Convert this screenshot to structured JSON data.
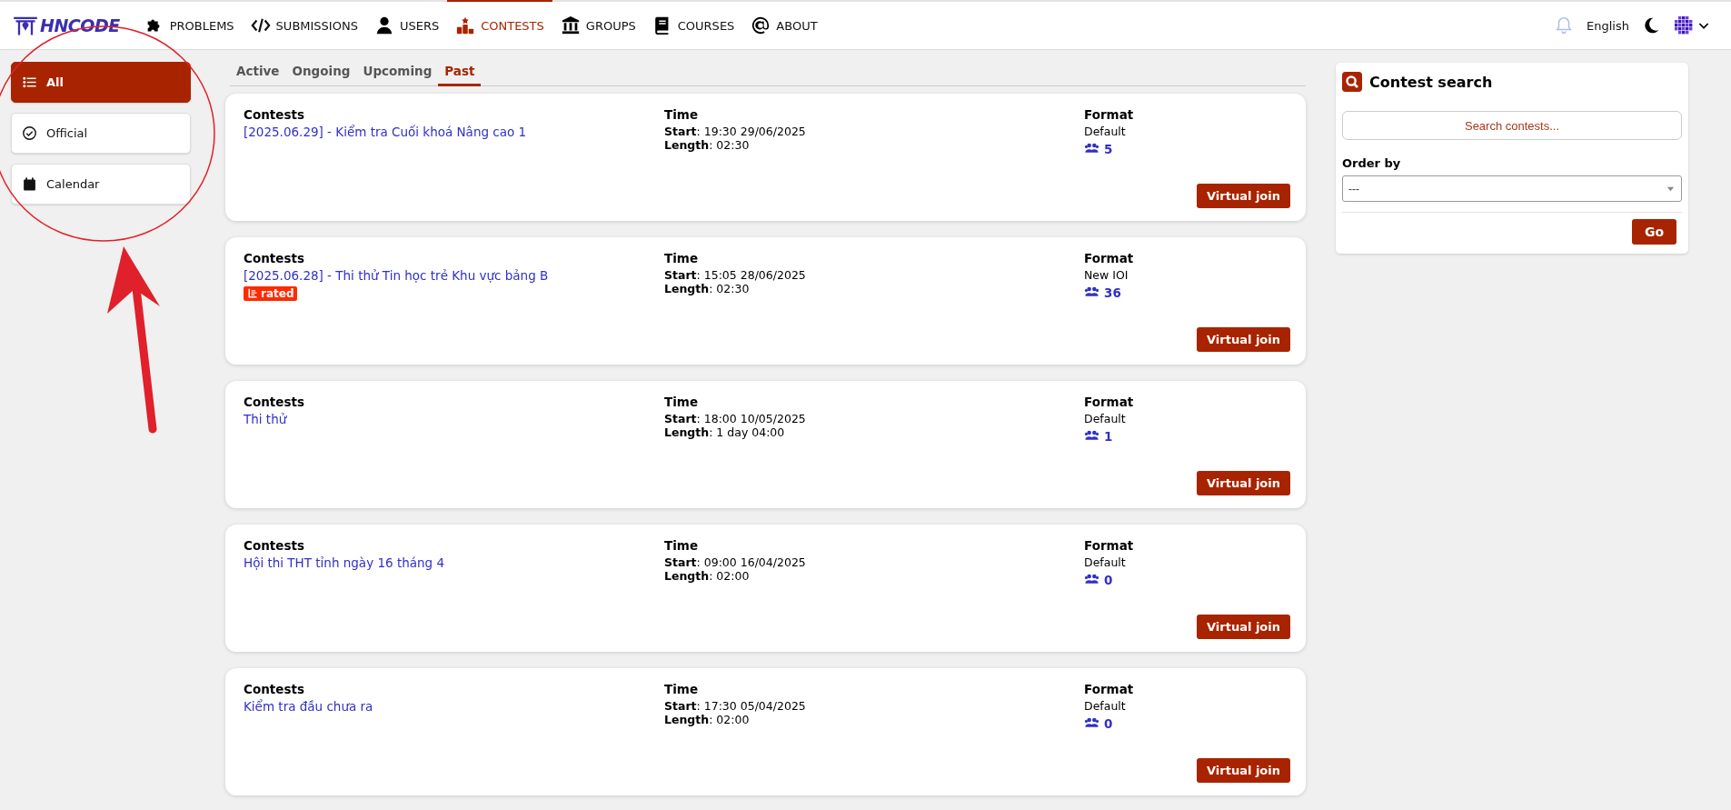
{
  "nav": {
    "logo": "HNCODE",
    "items": [
      {
        "label": "PROBLEMS",
        "selected": false
      },
      {
        "label": "SUBMISSIONS",
        "selected": false
      },
      {
        "label": "USERS",
        "selected": false
      },
      {
        "label": "CONTESTS",
        "selected": true
      },
      {
        "label": "GROUPS",
        "selected": false
      },
      {
        "label": "COURSES",
        "selected": false
      },
      {
        "label": "ABOUT",
        "selected": false
      }
    ],
    "language": "English"
  },
  "sidebar": {
    "items": [
      {
        "label": "All",
        "selected": true
      },
      {
        "label": "Official",
        "selected": false
      },
      {
        "label": "Calendar",
        "selected": false
      }
    ]
  },
  "tabs": [
    {
      "label": "Active",
      "selected": false
    },
    {
      "label": "Ongoing",
      "selected": false
    },
    {
      "label": "Upcoming",
      "selected": false
    },
    {
      "label": "Past",
      "selected": true
    }
  ],
  "contests": [
    {
      "headers": [
        "Contests",
        "Time",
        "Format"
      ],
      "name": "[2025.06.29] - Kiểm tra Cuối khoá Nâng cao 1",
      "start": "**Start**: 19:30 29/06/2025",
      "length": "**Length**: 02:30",
      "format": "Default",
      "participants": "5",
      "action": "Virtual join"
    },
    {
      "headers": [
        "Contests",
        "Time",
        "Format"
      ],
      "name": "[2025.06.28] - Thi thử Tin học trẻ Khu vực bảng B",
      "badge": "rated",
      "start": "**Start**: 15:05 28/06/2025",
      "length": "**Length**: 02:30",
      "format": "New IOI",
      "participants": "36",
      "action": "Virtual join"
    },
    {
      "headers": [
        "Contests",
        "Time",
        "Format"
      ],
      "name": "Thi thử",
      "start": "**Start**: 18:00 10/05/2025",
      "length": "**Length**: 1 day 04:00",
      "format": "Default",
      "participants": "1",
      "action": "Virtual join"
    },
    {
      "headers": [
        "Contests",
        "Time",
        "Format"
      ],
      "name": "Hội thi THT tỉnh ngày 16 tháng 4",
      "start": "**Start**: 09:00 16/04/2025",
      "length": "**Length**: 02:00",
      "format": "Default",
      "participants": "0",
      "action": "Virtual join"
    },
    {
      "headers": [
        "Contests",
        "Time",
        "Format"
      ],
      "name": "Kiểm tra đầu chưa ra",
      "start": "**Start**: 17:30 05/04/2025",
      "length": "**Length**: 02:00",
      "format": "Default",
      "participants": "0",
      "action": "Virtual join"
    }
  ],
  "search_panel": {
    "title": "Contest search",
    "placeholder": "Search contests...",
    "order_label": "Order by",
    "order_value": "---",
    "button": "Go"
  }
}
